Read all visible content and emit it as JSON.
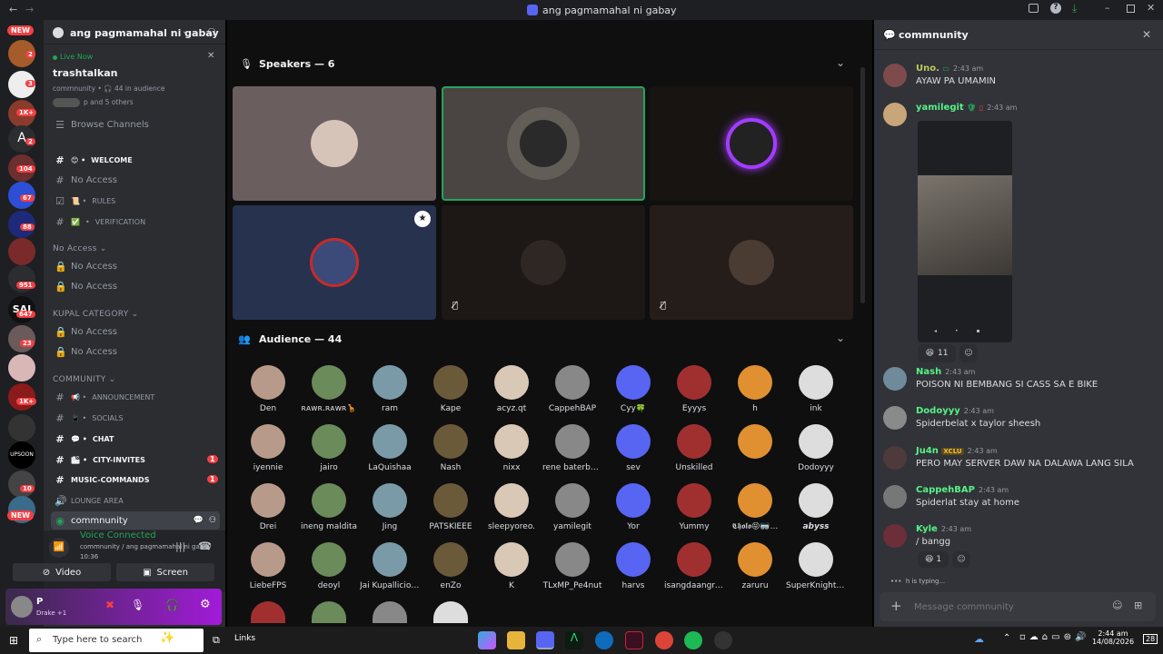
{
  "window": {
    "title": "ang pagmamahal ni gabay"
  },
  "colors": {
    "accent": "#5865f2",
    "green": "#23a55a",
    "red": "#f23f43"
  },
  "rail": {
    "badges": [
      "NEW",
      "2",
      "3",
      "1K+",
      "2",
      "104",
      "67",
      "88",
      "951",
      "647",
      "23",
      "1K+",
      "UPSOON",
      "10",
      "NEW"
    ],
    "labels": {
      "sai": "SAI",
      "a": "A"
    }
  },
  "server": {
    "name": "ang pagmamahal ni gabay"
  },
  "live": {
    "status": "Live Now",
    "title": "trashtalkan",
    "community": "commnunity",
    "audience": "44 in audience",
    "others": "p and 5 others"
  },
  "channels": {
    "browse": "Browse Channels",
    "top": [
      {
        "label": "WELCOME"
      },
      {
        "label": "No Access"
      },
      {
        "label": "RULES"
      },
      {
        "label": "VERIFICATION"
      }
    ],
    "cat1": "No Access",
    "cat1_items": [
      "No Access",
      "No Access"
    ],
    "cat2": "KUPAL CATEGORY",
    "cat2_items": [
      "No Access",
      "No Access"
    ],
    "cat3": "COMMUNITY",
    "cat3_items": [
      "ANNOUNCEMENT",
      "SOCIALS",
      "CHAT",
      "CITY-INVITES",
      "MUSIC-COMMANDS",
      "LOUNGE AREA",
      "commnunity"
    ],
    "unread": [
      "1",
      "1"
    ]
  },
  "voice": {
    "status": "Voice Connected",
    "location": "commnunity / ang pagmamahal ni gabay",
    "timer": "10:36",
    "video": "Video",
    "screen": "Screen"
  },
  "user": {
    "name": "P",
    "status": "Drake +1"
  },
  "stage": {
    "speakers_label": "Speakers — 6",
    "audience_label": "Audience — 44"
  },
  "audience": [
    "Den",
    "ʀᴀᴡʀ.ʀᴀᴡʀ🦒",
    "ram",
    "Kape",
    "acyz.qt",
    "CappehBAP",
    "Cyy🍀",
    "Eyyys",
    "h",
    "ink",
    "iyennie",
    "jairo",
    "LaQuishaa",
    "Nash",
    "nixx",
    "rene baterbon...",
    "sev",
    "Unskilled",
    "",
    "Dodoyyy",
    "Drei",
    "ineng maldita",
    "Jing",
    "PATSKIEEE",
    "sleepyoreo.",
    "yamilegit",
    "Yor",
    "Yummy",
    "𝕮𝖍𝖔𝖑𝖔😝🥽...",
    "𝙖𝙗𝙮𝙨𝙨",
    "LiebeFPS",
    "deoyl",
    "Jai Kupallicious",
    "enZo",
    "K",
    "TLxMP_Pe4nut",
    "harvs",
    "isangdaangro...",
    "zaruru",
    "SuperKnighth..."
  ],
  "chat": {
    "header": "commnunity",
    "messages": [
      {
        "name": "Uno.",
        "time": "2:43 am",
        "text": "AYAW PA UMAMIN",
        "color": "#bfc85a"
      },
      {
        "name": "yamilegit",
        "time": "2:43 am",
        "text": "",
        "color": "#57f287"
      },
      {
        "name": "Nash",
        "time": "2:43 am",
        "text": "POISON NI BEMBANG SI CASS SA E BIKE",
        "color": "#57f287"
      },
      {
        "name": "Dodoyyy",
        "time": "2:43 am",
        "text": "Spiderbelat x taylor sheesh",
        "color": "#57f287"
      },
      {
        "name": "Ju4n",
        "time": "2:43 am",
        "text": "PERO MAY SERVER DAW NA DALAWA LANG SILA",
        "color": "#57f287"
      },
      {
        "name": "CappehBAP",
        "time": "2:43 am",
        "text": "Spiderlat stay at home",
        "color": "#57f287"
      },
      {
        "name": "Kyle",
        "time": "2:43 am",
        "text": "/ bangg",
        "color": "#57f287"
      }
    ],
    "reaction1": "11",
    "reaction2": "1",
    "clan": "XCLU",
    "typing": "h is typing...",
    "placeholder": "Message commnunity"
  },
  "taskbar": {
    "search": "Type here to search",
    "links": "Links",
    "time": "2:44 am",
    "date": "14/08/2026",
    "notif": "28"
  }
}
